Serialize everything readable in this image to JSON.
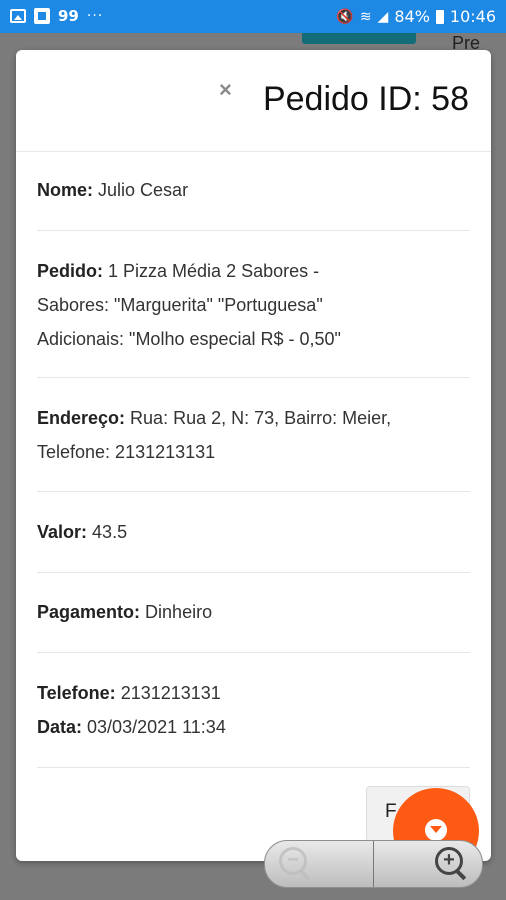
{
  "status_bar": {
    "notif_count": "99",
    "more": "···",
    "battery": "84%",
    "time": "10:46"
  },
  "background": {
    "partial_text": "Pre"
  },
  "modal": {
    "close": "×",
    "title": "Pedido ID: 58",
    "fields": {
      "nome_label": "Nome:",
      "nome_value": "Julio Cesar",
      "pedido_label": "Pedido:",
      "pedido_line1": "1 Pizza Média 2 Sabores -",
      "pedido_line2": "Sabores: \"Marguerita\" \"Portuguesa\"",
      "pedido_line3": "Adicionais: \"Molho especial R$ - 0,50\"",
      "endereco_label": "Endereço:",
      "endereco_line1": "Rua: Rua 2, N: 73, Bairro: Meier,",
      "endereco_line2": "Telefone: 2131213131",
      "valor_label": "Valor:",
      "valor_value": "43.5",
      "pagamento_label": "Pagamento:",
      "pagamento_value": "Dinheiro",
      "telefone_label": "Telefone:",
      "telefone_value": "2131213131",
      "data_label": "Data:",
      "data_value": "03/03/2021 11:34"
    },
    "footer_button": "F"
  },
  "zoom": {
    "minus_icon": "zoom-out-icon",
    "plus_icon": "zoom-in-icon"
  },
  "colors": {
    "status_bar": "#1e88e5",
    "fab": "#ff5a14",
    "teal": "#136d78"
  }
}
